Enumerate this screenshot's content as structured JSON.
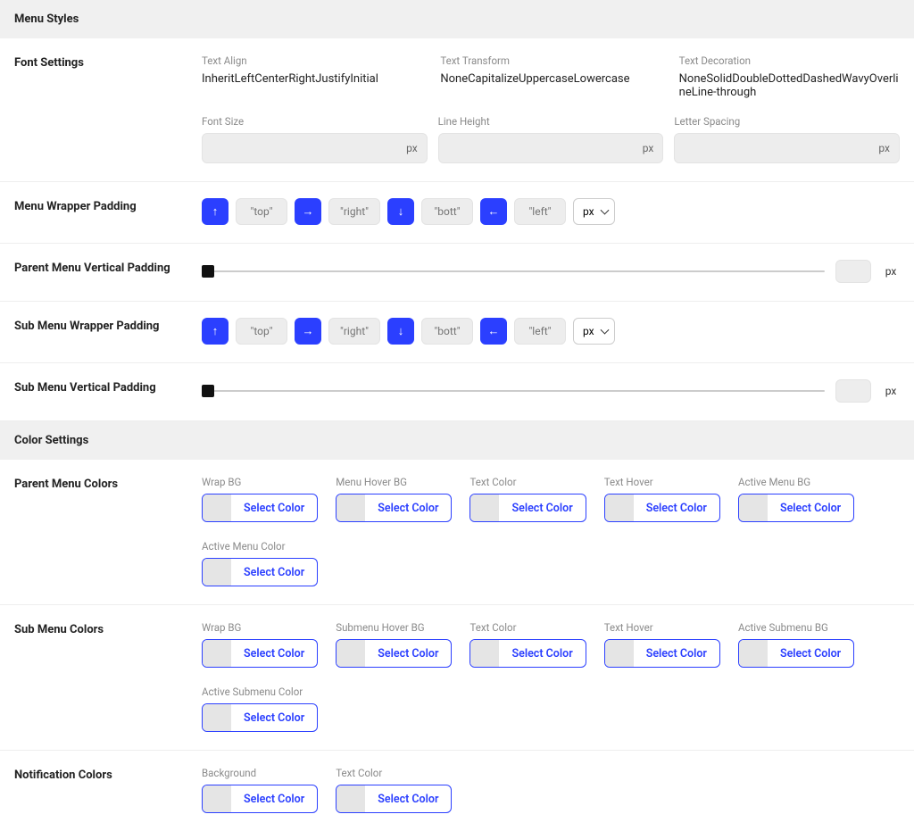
{
  "sections": {
    "menuStyles": "Menu Styles",
    "colorSettings": "Color Settings"
  },
  "fontSettings": {
    "rowLabel": "Font Settings",
    "textAlign": {
      "label": "Text Align",
      "value": "InheritLeftCenterRightJustifyInitial"
    },
    "textTransform": {
      "label": "Text Transform",
      "value": "NoneCapitalizeUppercaseLowercase"
    },
    "textDecoration": {
      "label": "Text Decoration",
      "value": "NoneSolidDoubleDottedDashedWavyOverlineLine-through"
    },
    "fontSize": {
      "label": "Font Size",
      "unit": "px"
    },
    "lineHeight": {
      "label": "Line Height",
      "unit": "px"
    },
    "letterSpacing": {
      "label": "Letter Spacing",
      "unit": "px"
    }
  },
  "menuWrapperPadding": {
    "rowLabel": "Menu Wrapper Padding",
    "top": "\"top\"",
    "right": "\"right\"",
    "bottom": "\"bott\"",
    "left": "\"left\"",
    "unit": "px"
  },
  "parentMenuVerticalPadding": {
    "rowLabel": "Parent Menu Vertical Padding",
    "unit": "px"
  },
  "subMenuWrapperPadding": {
    "rowLabel": "Sub Menu Wrapper Padding",
    "top": "\"top\"",
    "right": "\"right\"",
    "bottom": "\"bott\"",
    "left": "\"left\"",
    "unit": "px"
  },
  "subMenuVerticalPadding": {
    "rowLabel": "Sub Menu Vertical Padding",
    "unit": "px"
  },
  "parentMenuColors": {
    "rowLabel": "Parent Menu Colors",
    "fields": {
      "wrapBg": "Wrap BG",
      "menuHoverBg": "Menu Hover BG",
      "textColor": "Text Color",
      "textHover": "Text Hover",
      "activeMenuBg": "Active Menu BG",
      "activeMenuColor": "Active Menu Color"
    }
  },
  "subMenuColors": {
    "rowLabel": "Sub Menu Colors",
    "fields": {
      "wrapBg": "Wrap BG",
      "submenuHoverBg": "Submenu Hover BG",
      "textColor": "Text Color",
      "textHover": "Text Hover",
      "activeSubmenuBg": "Active Submenu BG",
      "activeSubmenuColor": "Active Submenu Color"
    }
  },
  "notificationColors": {
    "rowLabel": "Notification Colors",
    "fields": {
      "background": "Background",
      "textColor": "Text Color"
    }
  },
  "common": {
    "selectColor": "Select Color"
  }
}
